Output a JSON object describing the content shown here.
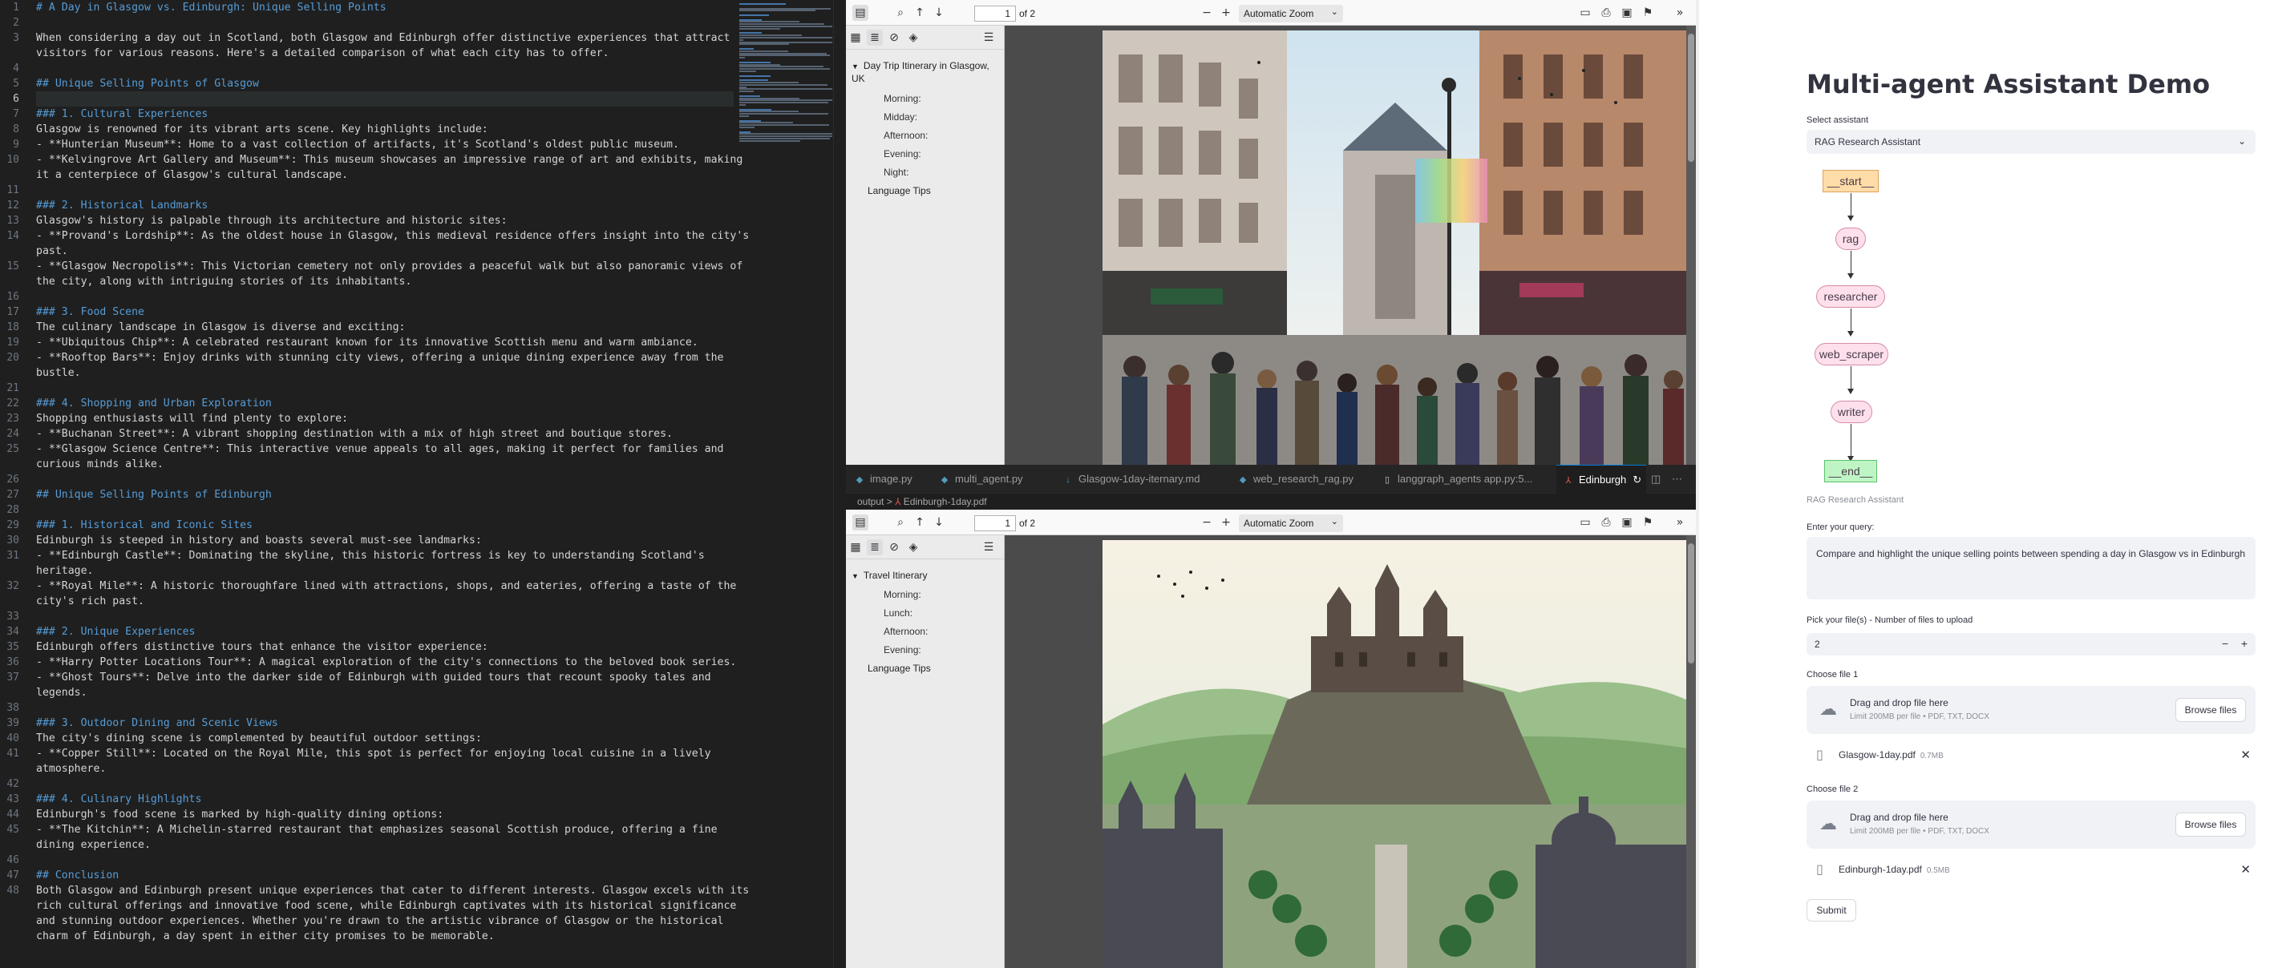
{
  "editor": {
    "lines": [
      {
        "n": "1",
        "text": "# A Day in Glasgow vs. Edinburgh: Unique Selling Points",
        "h": true
      },
      {
        "n": "2",
        "text": "",
        "h": false
      },
      {
        "n": "3",
        "text": "When considering a day out in Scotland, both Glasgow and Edinburgh offer distinctive experiences that attract",
        "h": false
      },
      {
        "n": "",
        "text": "visitors for various reasons. Here's a detailed comparison of what each city has to offer.",
        "h": false
      },
      {
        "n": "4",
        "text": "",
        "h": false
      },
      {
        "n": "5",
        "text": "## Unique Selling Points of Glasgow",
        "h": true
      },
      {
        "n": "6",
        "text": "",
        "h": false,
        "cur": true
      },
      {
        "n": "7",
        "text": "### 1. Cultural Experiences",
        "h": true
      },
      {
        "n": "8",
        "text": "Glasgow is renowned for its vibrant arts scene. Key highlights include:",
        "h": false
      },
      {
        "n": "9",
        "text": "- **Hunterian Museum**: Home to a vast collection of artifacts, it's Scotland's oldest public museum.",
        "h": false
      },
      {
        "n": "10",
        "text": "- **Kelvingrove Art Gallery and Museum**: This museum showcases an impressive range of art and exhibits, making",
        "h": false
      },
      {
        "n": "",
        "text": "it a centerpiece of Glasgow's cultural landscape.",
        "h": false
      },
      {
        "n": "11",
        "text": "",
        "h": false
      },
      {
        "n": "12",
        "text": "### 2. Historical Landmarks",
        "h": true
      },
      {
        "n": "13",
        "text": "Glasgow's history is palpable through its architecture and historic sites:",
        "h": false
      },
      {
        "n": "14",
        "text": "- **Provand's Lordship**: As the oldest house in Glasgow, this medieval residence offers insight into the city's",
        "h": false
      },
      {
        "n": "",
        "text": "past.",
        "h": false
      },
      {
        "n": "15",
        "text": "- **Glasgow Necropolis**: This Victorian cemetery not only provides a peaceful walk but also panoramic views of",
        "h": false
      },
      {
        "n": "",
        "text": "the city, along with intriguing stories of its inhabitants.",
        "h": false
      },
      {
        "n": "16",
        "text": "",
        "h": false
      },
      {
        "n": "17",
        "text": "### 3. Food Scene",
        "h": true
      },
      {
        "n": "18",
        "text": "The culinary landscape in Glasgow is diverse and exciting:",
        "h": false
      },
      {
        "n": "19",
        "text": "- **Ubiquitous Chip**: A celebrated restaurant known for its innovative Scottish menu and warm ambiance.",
        "h": false
      },
      {
        "n": "20",
        "text": "- **Rooftop Bars**: Enjoy drinks with stunning city views, offering a unique dining experience away from the",
        "h": false
      },
      {
        "n": "",
        "text": "bustle.",
        "h": false
      },
      {
        "n": "21",
        "text": "",
        "h": false
      },
      {
        "n": "22",
        "text": "### 4. Shopping and Urban Exploration",
        "h": true
      },
      {
        "n": "23",
        "text": "Shopping enthusiasts will find plenty to explore:",
        "h": false
      },
      {
        "n": "24",
        "text": "- **Buchanan Street**: A vibrant shopping destination with a mix of high street and boutique stores.",
        "h": false
      },
      {
        "n": "25",
        "text": "- **Glasgow Science Centre**: This interactive venue appeals to all ages, making it perfect for families and",
        "h": false
      },
      {
        "n": "",
        "text": "curious minds alike.",
        "h": false
      },
      {
        "n": "26",
        "text": "",
        "h": false
      },
      {
        "n": "27",
        "text": "## Unique Selling Points of Edinburgh",
        "h": true
      },
      {
        "n": "28",
        "text": "",
        "h": false
      },
      {
        "n": "29",
        "text": "### 1. Historical and Iconic Sites",
        "h": true
      },
      {
        "n": "30",
        "text": "Edinburgh is steeped in history and boasts several must-see landmarks:",
        "h": false
      },
      {
        "n": "31",
        "text": "- **Edinburgh Castle**: Dominating the skyline, this historic fortress is key to understanding Scotland's",
        "h": false
      },
      {
        "n": "",
        "text": "heritage.",
        "h": false
      },
      {
        "n": "32",
        "text": "- **Royal Mile**: A historic thoroughfare lined with attractions, shops, and eateries, offering a taste of the",
        "h": false
      },
      {
        "n": "",
        "text": "city's rich past.",
        "h": false
      },
      {
        "n": "33",
        "text": "",
        "h": false
      },
      {
        "n": "34",
        "text": "### 2. Unique Experiences",
        "h": true
      },
      {
        "n": "35",
        "text": "Edinburgh offers distinctive tours that enhance the visitor experience:",
        "h": false
      },
      {
        "n": "36",
        "text": "- **Harry Potter Locations Tour**: A magical exploration of the city's connections to the beloved book series.",
        "h": false
      },
      {
        "n": "37",
        "text": "- **Ghost Tours**: Delve into the darker side of Edinburgh with guided tours that recount spooky tales and",
        "h": false
      },
      {
        "n": "",
        "text": "legends.",
        "h": false
      },
      {
        "n": "38",
        "text": "",
        "h": false
      },
      {
        "n": "39",
        "text": "### 3. Outdoor Dining and Scenic Views",
        "h": true
      },
      {
        "n": "40",
        "text": "The city's dining scene is complemented by beautiful outdoor settings:",
        "h": false
      },
      {
        "n": "41",
        "text": "- **Copper Still**: Located on the Royal Mile, this spot is perfect for enjoying local cuisine in a lively",
        "h": false
      },
      {
        "n": "",
        "text": "atmosphere.",
        "h": false
      },
      {
        "n": "42",
        "text": "",
        "h": false
      },
      {
        "n": "43",
        "text": "### 4. Culinary Highlights",
        "h": true
      },
      {
        "n": "44",
        "text": "Edinburgh's food scene is marked by high-quality dining options:",
        "h": false
      },
      {
        "n": "45",
        "text": "- **The Kitchin**: A Michelin-starred restaurant that emphasizes seasonal Scottish produce, offering a fine",
        "h": false
      },
      {
        "n": "",
        "text": "dining experience.",
        "h": false
      },
      {
        "n": "46",
        "text": "",
        "h": false
      },
      {
        "n": "47",
        "text": "## Conclusion",
        "h": true
      },
      {
        "n": "48",
        "text": "Both Glasgow and Edinburgh present unique experiences that cater to different interests. Glasgow excels with its",
        "h": false
      },
      {
        "n": "",
        "text": "rich cultural offerings and innovative food scene, while Edinburgh captivates with its historical significance",
        "h": false
      },
      {
        "n": "",
        "text": "and stunning outdoor experiences. Whether you're drawn to the artistic vibrance of Glasgow or the historical",
        "h": false
      },
      {
        "n": "",
        "text": "charm of Edinburgh, a day spent in either city promises to be memorable.",
        "h": false
      }
    ]
  },
  "pdf_top": {
    "page_number": "1",
    "page_of": "of 2",
    "zoom": "Automatic Zoom",
    "outline_root": "Day Trip Itinerary in Glasgow, UK",
    "outline_items": [
      "Morning:",
      "Midday:",
      "Afternoon:",
      "Evening:",
      "Night:"
    ],
    "outline_extra": "Language Tips"
  },
  "pdf_bottom": {
    "page_number": "1",
    "page_of": "of 2",
    "zoom": "Automatic Zoom",
    "outline_root": "Travel Itinerary",
    "outline_items": [
      "Morning:",
      "Lunch:",
      "Afternoon:",
      "Evening:"
    ],
    "outline_extra": "Language Tips"
  },
  "tabs": [
    {
      "label": "image.py",
      "icon": "python",
      "active": false
    },
    {
      "label": "multi_agent.py",
      "icon": "python",
      "active": false
    },
    {
      "label": "Glasgow-1day-iternary.md",
      "icon": "markdown",
      "active": false
    },
    {
      "label": "web_research_rag.py",
      "icon": "python",
      "active": false
    },
    {
      "label": "langgraph_agents app.py:5...",
      "icon": "preview",
      "active": false
    },
    {
      "label": "Edinburgh",
      "icon": "pdf",
      "active": true
    }
  ],
  "breadcrumb": {
    "folder": "output",
    "sep": ">",
    "file": "Edinburgh-1day.pdf"
  },
  "app": {
    "title": "Multi-agent Assistant Demo",
    "assistant_label": "Select assistant",
    "assistant_value": "RAG Research Assistant",
    "graph_nodes": [
      "__start__",
      "rag",
      "researcher",
      "web_scraper",
      "writer",
      "__end__"
    ],
    "graph_caption": "RAG Research Assistant",
    "query_label": "Enter your query:",
    "query_value": "Compare and highlight the unique selling points between spending a day in Glasgow vs in Edinburgh",
    "files_label": "Pick your file(s) - Number of files to upload",
    "files_count": "2",
    "file1_label": "Choose file 1",
    "file2_label": "Choose file 2",
    "drop_text": "Drag and drop file here",
    "drop_limit": "Limit 200MB per file • PDF, TXT, DOCX",
    "browse_label": "Browse files",
    "file1_name": "Glasgow-1day.pdf",
    "file1_size": "0.7MB",
    "file2_name": "Edinburgh-1day.pdf",
    "file2_size": "0.5MB",
    "submit_label": "Submit"
  }
}
